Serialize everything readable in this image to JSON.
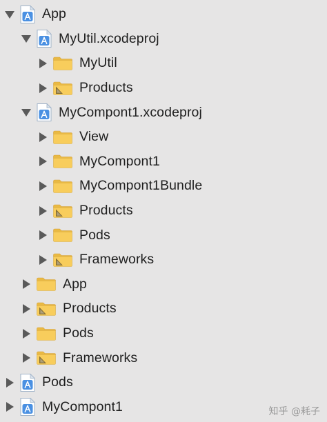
{
  "colors": {
    "background": "#e6e5e5",
    "folder_yellow": "#f8cd5c",
    "project_blue": "#4a90e2",
    "text": "#1f1f1f"
  },
  "tree": [
    {
      "label": "App",
      "type": "project",
      "expanded": true,
      "depth": 0
    },
    {
      "label": "MyUtil.xcodeproj",
      "type": "project",
      "expanded": true,
      "depth": 1
    },
    {
      "label": "MyUtil",
      "type": "folder",
      "expanded": false,
      "depth": 2
    },
    {
      "label": "Products",
      "type": "products-folder",
      "expanded": false,
      "depth": 2
    },
    {
      "label": "MyCompont1.xcodeproj",
      "type": "project",
      "expanded": true,
      "depth": 1
    },
    {
      "label": "View",
      "type": "folder",
      "expanded": false,
      "depth": 2
    },
    {
      "label": "MyCompont1",
      "type": "folder",
      "expanded": false,
      "depth": 2
    },
    {
      "label": "MyCompont1Bundle",
      "type": "folder",
      "expanded": false,
      "depth": 2
    },
    {
      "label": "Products",
      "type": "products-folder",
      "expanded": false,
      "depth": 2
    },
    {
      "label": "Pods",
      "type": "folder",
      "expanded": false,
      "depth": 2
    },
    {
      "label": "Frameworks",
      "type": "products-folder",
      "expanded": false,
      "depth": 2
    },
    {
      "label": "App",
      "type": "folder",
      "expanded": false,
      "depth": 1
    },
    {
      "label": "Products",
      "type": "products-folder",
      "expanded": false,
      "depth": 1
    },
    {
      "label": "Pods",
      "type": "folder",
      "expanded": false,
      "depth": 1
    },
    {
      "label": "Frameworks",
      "type": "products-folder",
      "expanded": false,
      "depth": 1
    },
    {
      "label": "Pods",
      "type": "project",
      "expanded": false,
      "depth": 0
    },
    {
      "label": "MyCompont1",
      "type": "project",
      "expanded": false,
      "depth": 0
    }
  ],
  "watermark": "知乎 @耗子"
}
